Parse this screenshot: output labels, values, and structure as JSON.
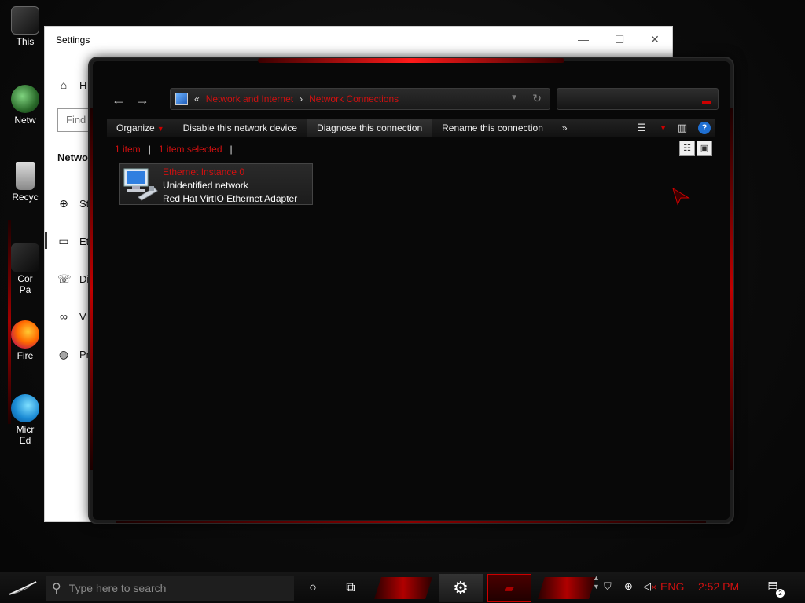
{
  "desktop": {
    "icons": [
      {
        "label": "This",
        "name": "this-pc"
      },
      {
        "label": "Netw",
        "name": "network"
      },
      {
        "label": "Recyc",
        "name": "recycle-bin"
      },
      {
        "label": "Cor\nPa",
        "name": "control-panel"
      },
      {
        "label": "Fire",
        "name": "firefox"
      },
      {
        "label": "Micr\nEd",
        "name": "microsoft-edge"
      }
    ]
  },
  "settings": {
    "title": "Settings",
    "home_label": "H",
    "find_placeholder": "Find",
    "section_title": "Netwo",
    "items": [
      {
        "icon": "globe-icon",
        "label": "St"
      },
      {
        "icon": "ethernet-icon",
        "label": "Et"
      },
      {
        "icon": "dialup-icon",
        "label": "Di"
      },
      {
        "icon": "vpn-icon",
        "label": "V"
      },
      {
        "icon": "proxy-icon",
        "label": "Pr"
      }
    ],
    "controls": {
      "minimize": "—",
      "maximize": "☐",
      "close": "✕"
    }
  },
  "explorer": {
    "address": {
      "prefix": "«",
      "crumbs": [
        "Network and Internet",
        "Network Connections"
      ],
      "separator": "›"
    },
    "toolbar": {
      "organize": "Organize",
      "disable": "Disable this network device",
      "diagnose": "Diagnose this connection",
      "rename": "Rename this connection",
      "more": "»"
    },
    "status": {
      "count": "1 item",
      "selected": "1 item selected",
      "separator": "|"
    },
    "item": {
      "name": "Ethernet Instance 0",
      "status": "Unidentified network",
      "adapter": "Red Hat VirtIO Ethernet Adapter"
    },
    "help_label": "?"
  },
  "taskbar": {
    "search_placeholder": "Type here to search",
    "language": "ENG",
    "time": "2:52 PM",
    "notification_count": "2"
  },
  "colors": {
    "accent_red": "#d01010",
    "dark_bg": "#080808"
  }
}
